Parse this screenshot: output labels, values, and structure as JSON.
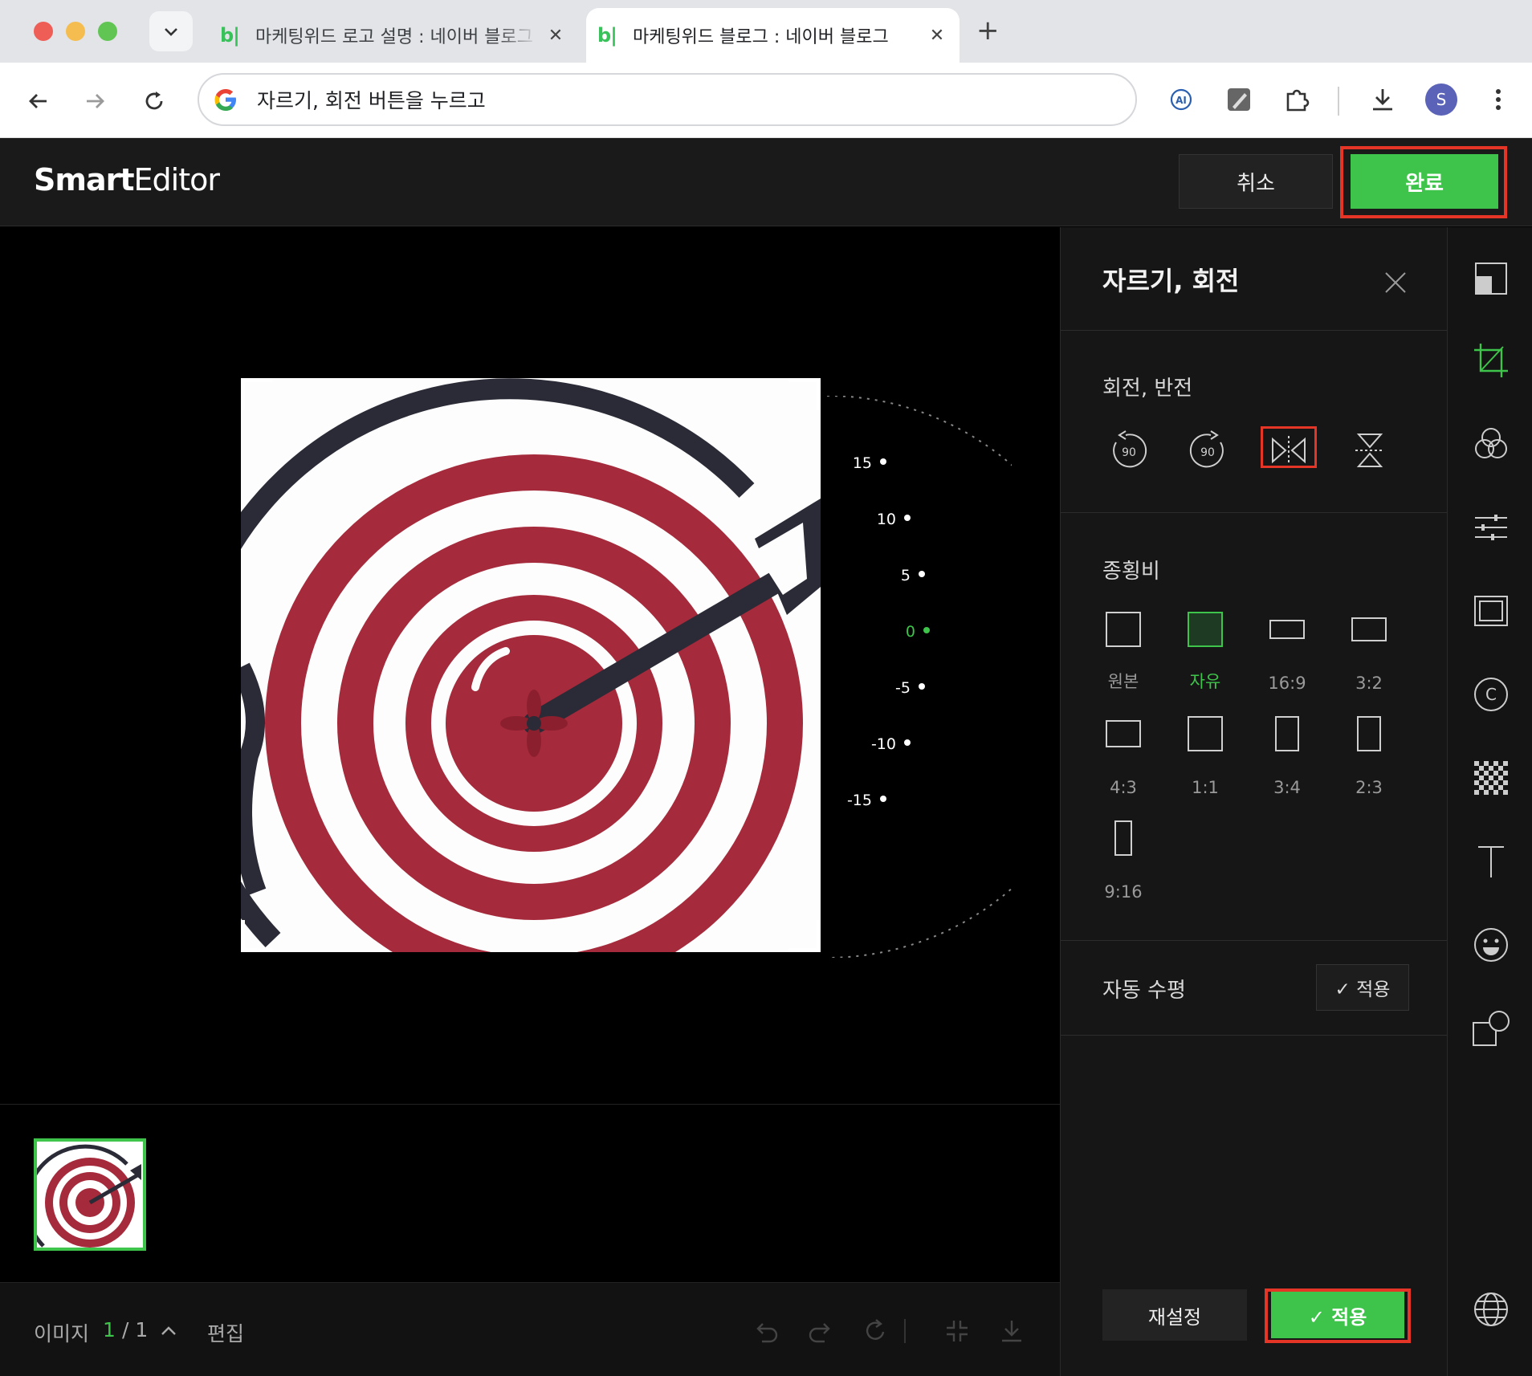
{
  "browser": {
    "tabs": [
      {
        "favicon": "b|",
        "title": "마케팅위드 로고 설명 : 네이버 블로그",
        "active": false
      },
      {
        "favicon": "b|",
        "title": "마케팅위드 블로그 : 네이버 블로그",
        "active": true
      }
    ],
    "new_tab": "+",
    "close_glyph": "✕",
    "omnibox": {
      "query": "자르기, 회전 버튼을 누르고"
    },
    "profile_initial": "S"
  },
  "editor": {
    "logo_bold": "Smart",
    "logo_light": "Editor",
    "cancel_label": "취소",
    "done_label": "완료"
  },
  "dial": {
    "ticks": [
      "15",
      "10",
      "5",
      "0",
      "-5",
      "-10",
      "-15"
    ],
    "active": "0"
  },
  "footer": {
    "image_label": "이미지",
    "image_index": "1",
    "image_total": "/ 1",
    "edit_label": "편집"
  },
  "panel": {
    "title": "자르기, 회전",
    "rotate_section": "회전, 반전",
    "rotate_buttons": [
      {
        "icon": "rotate-left-90-icon",
        "label": "90"
      },
      {
        "icon": "rotate-right-90-icon",
        "label": "90"
      },
      {
        "icon": "flip-horizontal-icon",
        "label": ""
      },
      {
        "icon": "flip-vertical-icon",
        "label": ""
      }
    ],
    "ratio_section": "종횡비",
    "ratios": [
      {
        "label": "원본",
        "selected": false
      },
      {
        "label": "자유",
        "selected": true
      },
      {
        "label": "16:9",
        "selected": false
      },
      {
        "label": "3:2",
        "selected": false
      },
      {
        "label": "4:3",
        "selected": false
      },
      {
        "label": "1:1",
        "selected": false
      },
      {
        "label": "3:4",
        "selected": false
      },
      {
        "label": "2:3",
        "selected": false
      },
      {
        "label": "9:16",
        "selected": false
      }
    ],
    "auto_level_label": "자동 수평",
    "auto_level_button": "✓ 적용",
    "reset_label": "재설정",
    "apply_label": "✓ 적용"
  },
  "colors": {
    "accent_green": "#3ec44a",
    "highlight_red": "#e53527",
    "target_red": "#a52a3b",
    "dart_dark": "#2a2b36"
  }
}
